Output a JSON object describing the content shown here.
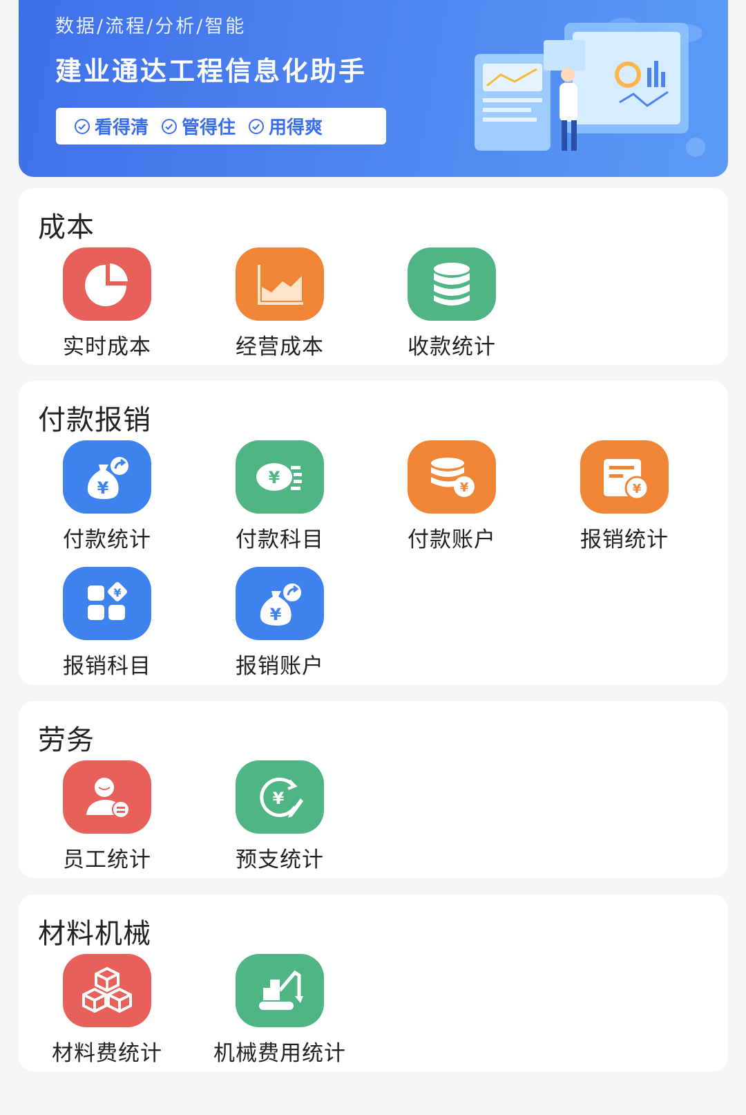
{
  "banner": {
    "tagline": "数据/流程/分析/智能",
    "title": "建业通达工程信息化助手",
    "pills": [
      "看得清",
      "管得住",
      "用得爽"
    ]
  },
  "sections": [
    {
      "title": "成本",
      "items": [
        {
          "label": "实时成本",
          "icon": "pie-chart-icon",
          "color": "#e8605a"
        },
        {
          "label": "经营成本",
          "icon": "area-chart-icon",
          "color": "#f08536"
        },
        {
          "label": "收款统计",
          "icon": "database-icon",
          "color": "#4fb583"
        }
      ]
    },
    {
      "title": "付款报销",
      "items": [
        {
          "label": "付款统计",
          "icon": "money-bag-icon",
          "color": "#3e82ee"
        },
        {
          "label": "付款科目",
          "icon": "cash-list-icon",
          "color": "#4fb583"
        },
        {
          "label": "付款账户",
          "icon": "coins-stack-icon",
          "color": "#f08536"
        },
        {
          "label": "报销统计",
          "icon": "invoice-yen-icon",
          "color": "#f08536"
        },
        {
          "label": "报销科目",
          "icon": "category-grid-icon",
          "color": "#3e82ee"
        },
        {
          "label": "报销账户",
          "icon": "money-bag-icon",
          "color": "#3e82ee"
        }
      ]
    },
    {
      "title": "劳务",
      "items": [
        {
          "label": "员工统计",
          "icon": "employee-icon",
          "color": "#e8605a"
        },
        {
          "label": "预支统计",
          "icon": "advance-payment-icon",
          "color": "#4fb583"
        }
      ]
    },
    {
      "title": "材料机械",
      "items": [
        {
          "label": "材料费统计",
          "icon": "boxes-icon",
          "color": "#e8605a"
        },
        {
          "label": "机械费用统计",
          "icon": "excavator-icon",
          "color": "#4fb583"
        }
      ]
    }
  ]
}
